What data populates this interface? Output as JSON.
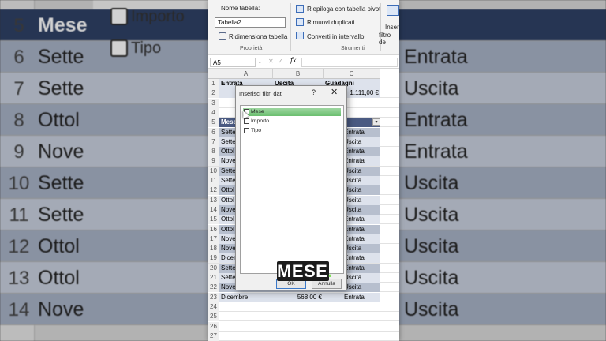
{
  "background": {
    "rows": [
      {
        "n": "5",
        "a": "Mese",
        "c": ""
      },
      {
        "n": "6",
        "a": "Sette",
        "c": "Entrata"
      },
      {
        "n": "7",
        "a": "Sette",
        "c": "Uscita"
      },
      {
        "n": "8",
        "a": "Ottol",
        "c": "Entrata"
      },
      {
        "n": "9",
        "a": "Nove",
        "c": "Entrata"
      },
      {
        "n": "10",
        "a": "Sette",
        "c": "Uscita"
      },
      {
        "n": "11",
        "a": "Sette",
        "c": "Uscita"
      },
      {
        "n": "12",
        "a": "Ottol",
        "c": "Uscita"
      },
      {
        "n": "13",
        "a": "Ottol",
        "c": "Uscita"
      },
      {
        "n": "14",
        "a": "Nove",
        "c": "Uscita"
      }
    ],
    "panel_items": [
      "Importo",
      "Tipo"
    ]
  },
  "ribbon": {
    "table_name_label": "Nome tabella:",
    "table_name_value": "Tabella2",
    "resize_label": "Ridimensiona tabella",
    "group_properties": "Proprietà",
    "pivot_label": "Riepiloga con tabella pivot",
    "remove_dup_label": "Rimuovi duplicati",
    "convert_label": "Converti in intervallo",
    "group_tools": "Strumenti",
    "insert_slicer_label": "Inseris",
    "insert_slicer_label2": "filtro de"
  },
  "formula_bar": {
    "name_box": "A5",
    "fx": "fx"
  },
  "columns": [
    "A",
    "B",
    "C"
  ],
  "grid": {
    "rows": [
      {
        "n": "1",
        "a": "Entrata",
        "b": "Uscita",
        "c": "Guadagni",
        "style": "light"
      },
      {
        "n": "2",
        "a": "",
        "b": "",
        "c": "1.111,00 €",
        "style": "light"
      },
      {
        "n": "3",
        "a": "",
        "b": "",
        "c": "",
        "style": "none"
      },
      {
        "n": "4",
        "a": "",
        "b": "",
        "c": "",
        "style": "none"
      },
      {
        "n": "5",
        "a": "Mese",
        "b": "",
        "c": "",
        "style": "hdr"
      },
      {
        "n": "6",
        "a": "Sette",
        "b": "",
        "c": "Entrata",
        "style": "dark"
      },
      {
        "n": "7",
        "a": "Sette",
        "b": "",
        "c": "Uscita",
        "style": "light"
      },
      {
        "n": "8",
        "a": "Ottol",
        "b": "",
        "c": "Entrata",
        "style": "dark"
      },
      {
        "n": "9",
        "a": "Nove",
        "b": "",
        "c": "Entrata",
        "style": "light"
      },
      {
        "n": "10",
        "a": "Sette",
        "b": "",
        "c": "Uscita",
        "style": "dark"
      },
      {
        "n": "11",
        "a": "Sette",
        "b": "",
        "c": "Uscita",
        "style": "light"
      },
      {
        "n": "12",
        "a": "Ottol",
        "b": "",
        "c": "Uscita",
        "style": "dark"
      },
      {
        "n": "13",
        "a": "Ottol",
        "b": "",
        "c": "Uscita",
        "style": "light"
      },
      {
        "n": "14",
        "a": "Nove",
        "b": "",
        "c": "Uscita",
        "style": "dark"
      },
      {
        "n": "15",
        "a": "Ottol",
        "b": "",
        "c": "Entrata",
        "style": "light"
      },
      {
        "n": "16",
        "a": "Ottol",
        "b": "",
        "c": "Entrata",
        "style": "dark"
      },
      {
        "n": "17",
        "a": "Nove",
        "b": "",
        "c": "Entrata",
        "style": "light"
      },
      {
        "n": "18",
        "a": "Nove",
        "b": "",
        "c": "Uscita",
        "style": "dark"
      },
      {
        "n": "19",
        "a": "Dicer",
        "b": "",
        "c": "Entrata",
        "style": "light"
      },
      {
        "n": "20",
        "a": "Sette",
        "b": "",
        "c": "Entrata",
        "style": "dark"
      },
      {
        "n": "21",
        "a": "Sette",
        "b": "",
        "c": "Uscita",
        "style": "light"
      },
      {
        "n": "22",
        "a": "Nove",
        "b": "",
        "c": "Uscita",
        "style": "dark"
      },
      {
        "n": "23",
        "a": "Dicembre",
        "b": "568,00 €",
        "c": "Entrata",
        "style": "light"
      },
      {
        "n": "24",
        "a": "",
        "b": "",
        "c": "",
        "style": "none"
      },
      {
        "n": "25",
        "a": "",
        "b": "",
        "c": "",
        "style": "none"
      },
      {
        "n": "26",
        "a": "",
        "b": "",
        "c": "",
        "style": "none"
      },
      {
        "n": "27",
        "a": "",
        "b": "",
        "c": "",
        "style": "none"
      }
    ]
  },
  "dialog": {
    "title": "Inserisci filtri dati",
    "help": "?",
    "close": "✕",
    "items": [
      {
        "label": "Mese",
        "selected": true
      },
      {
        "label": "Importo",
        "selected": false
      },
      {
        "label": "Tipo",
        "selected": false
      }
    ],
    "ok": "OK",
    "cancel": "Annulla"
  },
  "caption": {
    "text": "MESE",
    "dot": "."
  }
}
